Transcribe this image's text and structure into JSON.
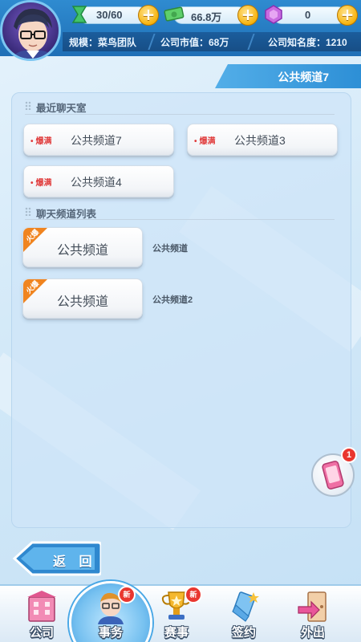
{
  "resources": {
    "stamina": "30/60",
    "money": "66.8万",
    "gems": "0"
  },
  "company": {
    "scale": "规模：菜鸟团队",
    "market_value": "公司市值：68万",
    "fame": "公司知名度：1210"
  },
  "channel_header": "公共频道7",
  "recent": {
    "title": "最近聊天室",
    "rooms": [
      {
        "status": "爆满",
        "name": "公共频道7"
      },
      {
        "status": "爆满",
        "name": "公共频道3"
      },
      {
        "status": "爆满",
        "name": "公共频道4"
      }
    ]
  },
  "channel_list": {
    "title": "聊天频道列表",
    "items": [
      {
        "badge": "火爆",
        "name": "公共频道",
        "desc": "公共频道"
      },
      {
        "badge": "火爆",
        "name": "公共频道",
        "desc": "公共频道2"
      }
    ]
  },
  "phone_badge": "1",
  "back_label": "返 回",
  "nav": {
    "items": [
      {
        "label": "公司",
        "badge": ""
      },
      {
        "label": "事务",
        "badge": "新"
      },
      {
        "label": "赛事",
        "badge": "新"
      },
      {
        "label": "签约",
        "badge": ""
      },
      {
        "label": "外出",
        "badge": ""
      }
    ]
  },
  "colors": {
    "accent_blue": "#2d8fd6",
    "full_red": "#e03c3c",
    "hot_orange": "#f0841f",
    "badge_red": "#e9362f"
  }
}
